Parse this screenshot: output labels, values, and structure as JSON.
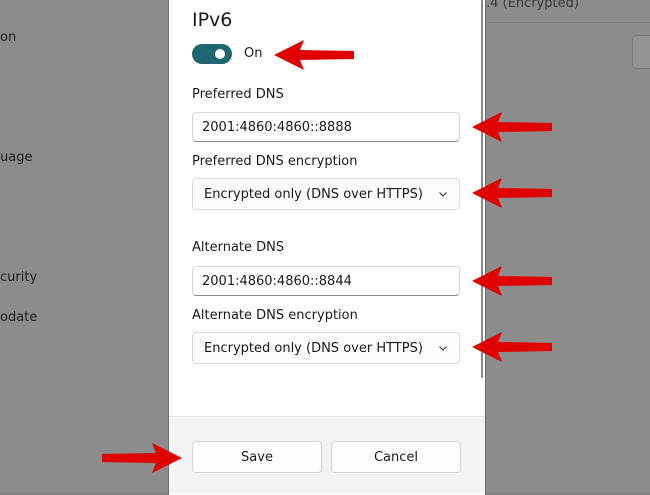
{
  "background": {
    "left_labels": [
      "on",
      "uage",
      "curity",
      "odate"
    ],
    "right_text": ".4 (Encrypted)"
  },
  "dialog": {
    "title": "IPv6",
    "toggle": {
      "state_label": "On",
      "checked": true
    },
    "preferred_dns": {
      "label": "Preferred DNS",
      "value": "2001:4860:4860::8888"
    },
    "preferred_encryption": {
      "label": "Preferred DNS encryption",
      "selected": "Encrypted only (DNS over HTTPS)"
    },
    "alternate_dns": {
      "label": "Alternate DNS",
      "value": "2001:4860:4860::8844"
    },
    "alternate_encryption": {
      "label": "Alternate DNS encryption",
      "selected": "Encrypted only (DNS over HTTPS)"
    },
    "footer": {
      "save_label": "Save",
      "cancel_label": "Cancel"
    }
  },
  "colors": {
    "accent": "#1f6670",
    "annotation_arrow": "#e00000",
    "overlay": "#8c8c8c"
  },
  "icons": [
    "chevron-down-icon",
    "red-arrow-annotation"
  ]
}
